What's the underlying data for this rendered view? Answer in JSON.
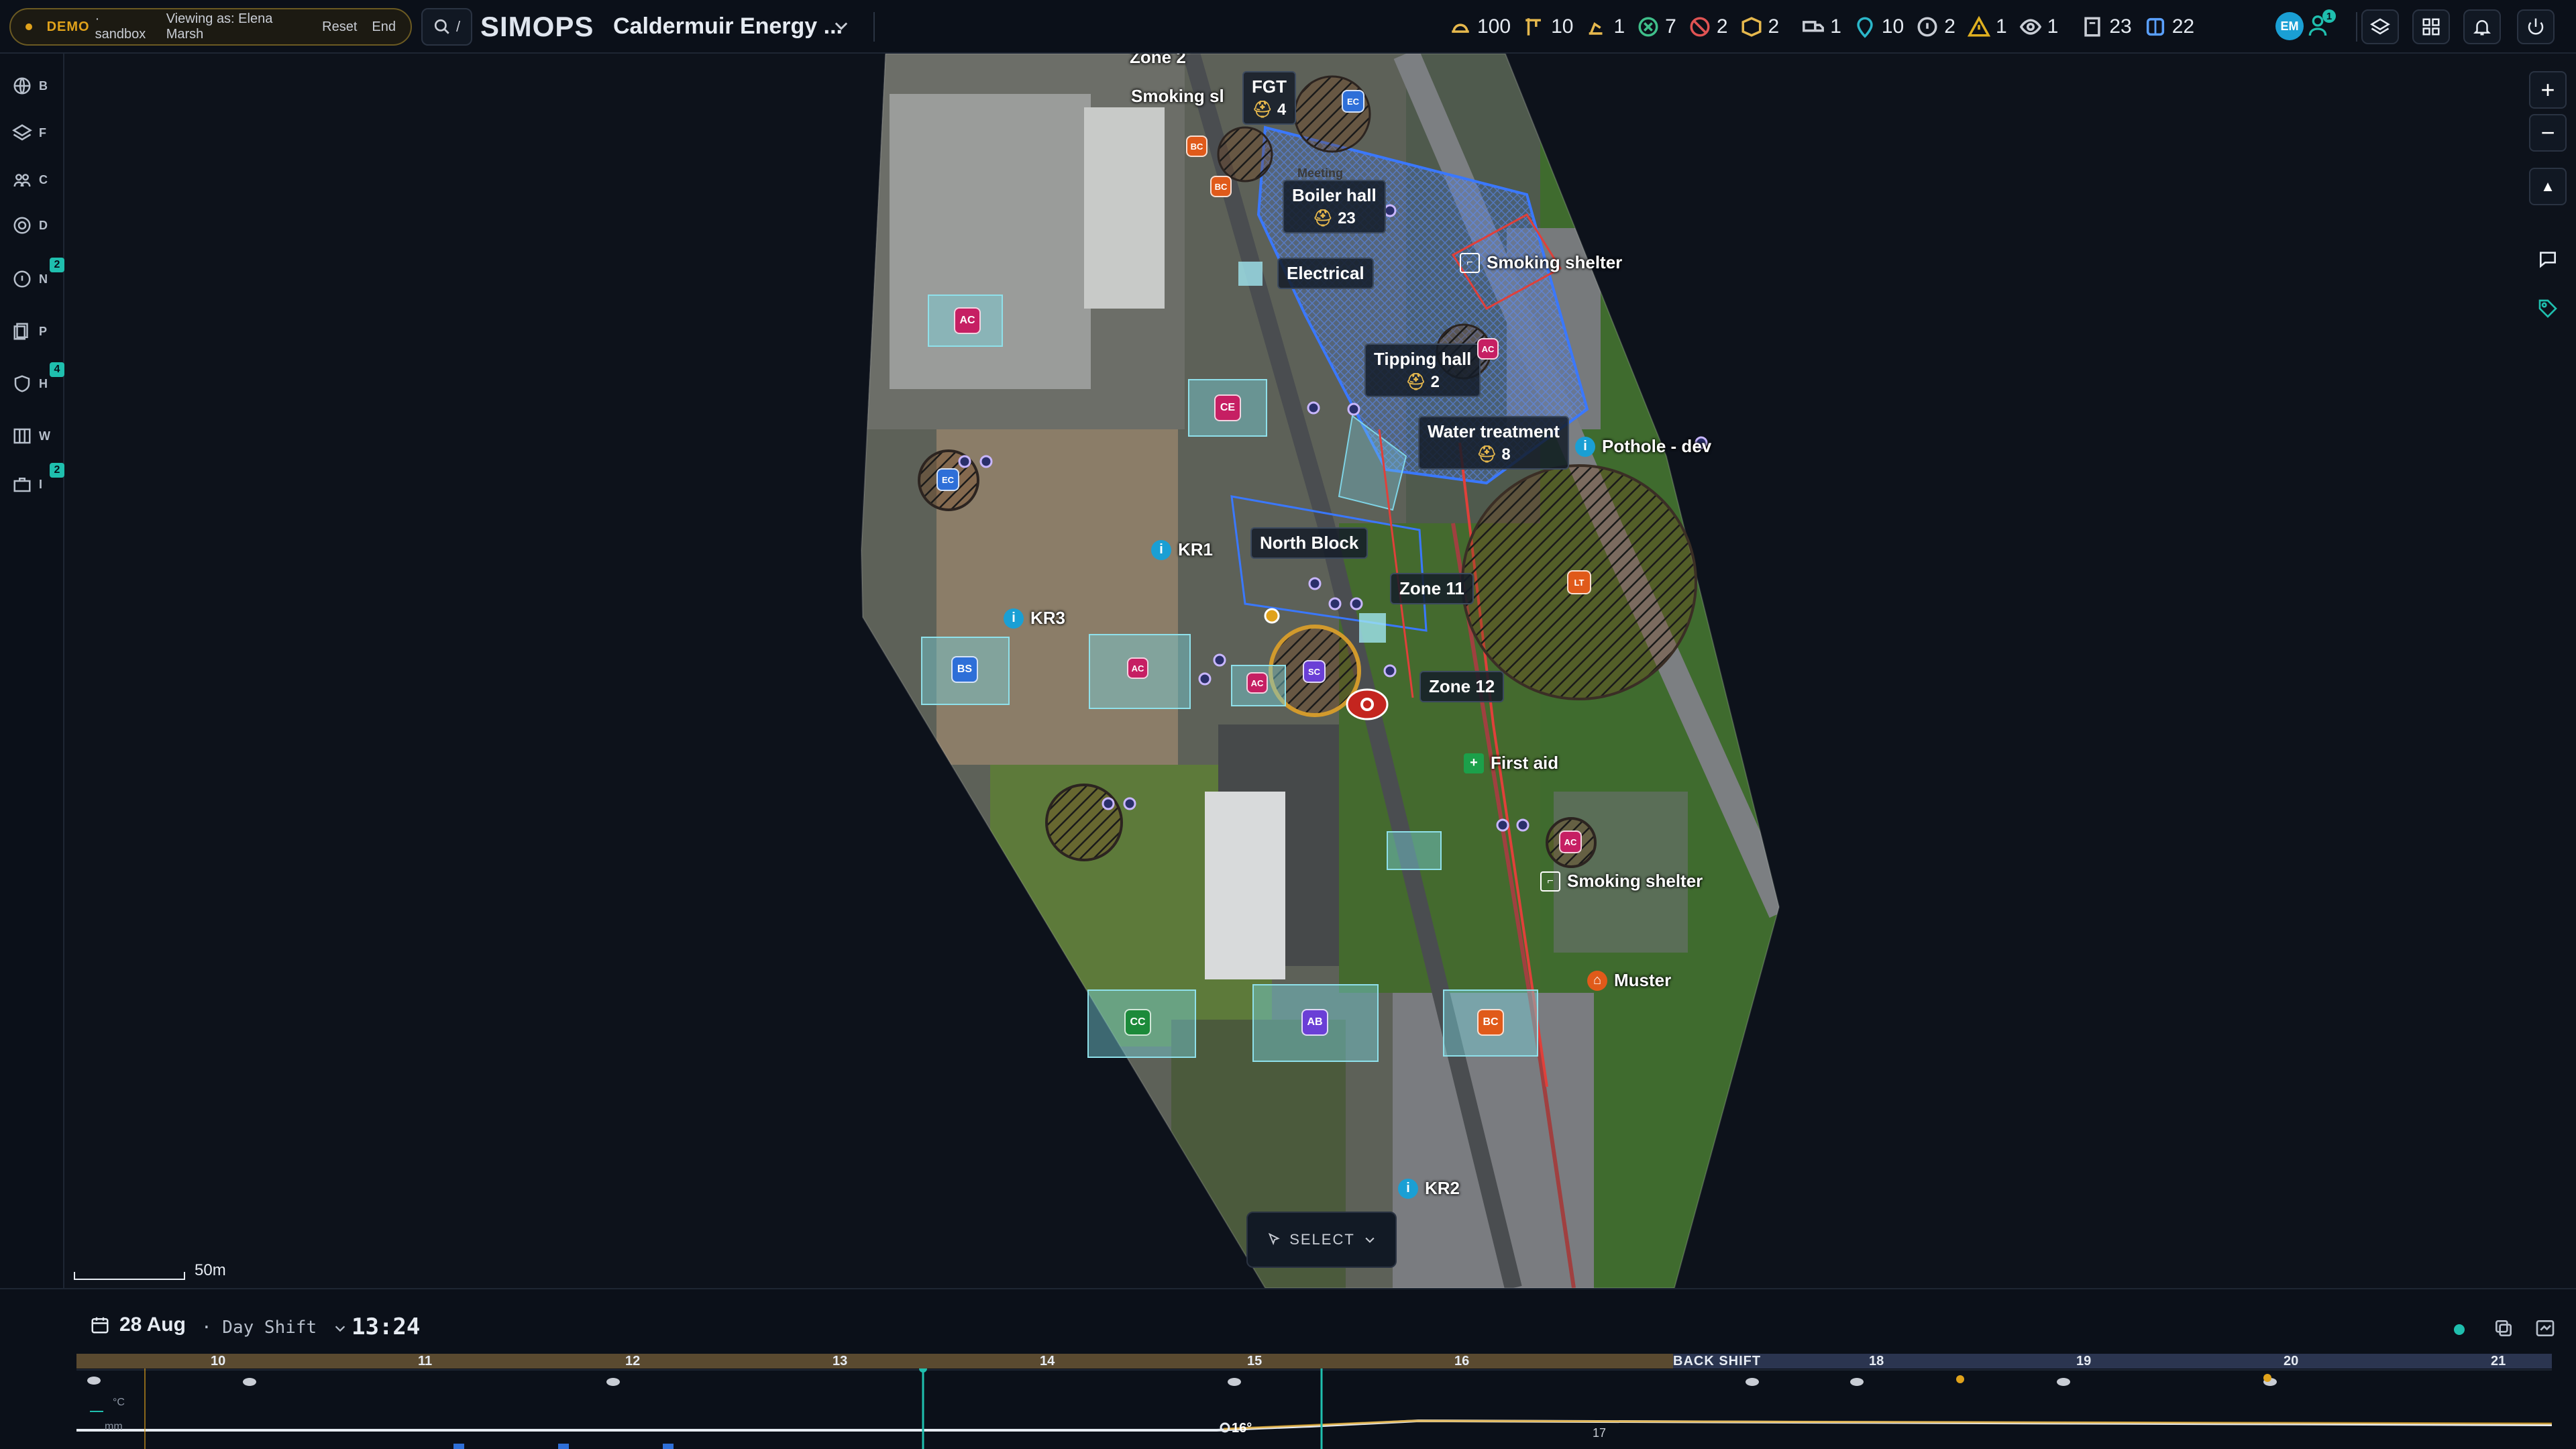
{
  "demo": {
    "tag": "DEMO",
    "env": "· sandbox",
    "viewing": "Viewing as: Elena Marsh",
    "reset": "Reset",
    "end": "End"
  },
  "search": {
    "shortcut": "/"
  },
  "app": {
    "logo": "SIMOPS",
    "site": "Caldermuir Energy ..."
  },
  "stats": [
    {
      "icon": "hardhat-icon",
      "value": "100",
      "color": "#e6b84d"
    },
    {
      "icon": "crane-icon",
      "value": "10",
      "color": "#e6b84d"
    },
    {
      "icon": "excavator-icon",
      "value": "1",
      "color": "#e6b84d"
    },
    {
      "icon": "hazard-icon",
      "value": "7",
      "color": "#3fbf8a"
    },
    {
      "icon": "prohibited-icon",
      "value": "2",
      "color": "#e05353"
    },
    {
      "icon": "box-icon",
      "value": "2",
      "color": "#e6b84d"
    },
    {
      "icon": "truck-icon",
      "value": "1",
      "color": "#c9cdd5"
    },
    {
      "icon": "location-icon",
      "value": "10",
      "color": "#2bb6c9"
    },
    {
      "icon": "info-icon",
      "value": "2",
      "color": "#c9cdd5"
    },
    {
      "icon": "warning-icon",
      "value": "1",
      "color": "#e0b020"
    },
    {
      "icon": "eye-icon",
      "value": "1",
      "color": "#c9cdd5"
    },
    {
      "icon": "building-icon",
      "value": "23",
      "color": "#c9cdd5"
    },
    {
      "icon": "grid-icon",
      "value": "22",
      "color": "#5aa0ff"
    }
  ],
  "user": {
    "initials": "EM",
    "team_badge": "1"
  },
  "rail": [
    {
      "letter": "B",
      "icon": "globe-icon",
      "badge": ""
    },
    {
      "letter": "F",
      "icon": "layers-icon",
      "badge": ""
    },
    {
      "letter": "C",
      "icon": "group-icon",
      "badge": ""
    },
    {
      "letter": "D",
      "icon": "target-icon",
      "badge": ""
    },
    {
      "letter": "N",
      "icon": "info-icon",
      "badge": "2"
    },
    {
      "letter": "P",
      "icon": "permit-icon",
      "badge": ""
    },
    {
      "letter": "H",
      "icon": "shield-icon",
      "badge": "4"
    },
    {
      "letter": "W",
      "icon": "columns-icon",
      "badge": ""
    },
    {
      "letter": "I",
      "icon": "toolbox-icon",
      "badge": "2"
    }
  ],
  "map": {
    "boxes": [
      {
        "title": "FGT",
        "count": "4"
      },
      {
        "title": "Boiler hall",
        "count": "23"
      },
      {
        "title": "Electrical",
        "count": ""
      },
      {
        "title": "Tipping hall",
        "count": "2"
      },
      {
        "title": "Water treatment",
        "count": "8"
      },
      {
        "title": "North Block",
        "count": ""
      },
      {
        "title": "Zone 11",
        "count": ""
      },
      {
        "title": "Zone 12",
        "count": ""
      }
    ],
    "labels": {
      "zone2": "Zone 2",
      "smoking1": "Smoking sl",
      "meeting": "Meeting",
      "kr1": "KR1",
      "kr3": "KR3",
      "kr2": "KR2"
    },
    "pins": [
      {
        "text": "Smoking shelter",
        "icon": "smoking-icon"
      },
      {
        "text": "Pothole - dev",
        "icon": "info-icon"
      },
      {
        "text": "First aid",
        "icon": "first-aid-icon"
      },
      {
        "text": "Smoking shelter",
        "icon": "smoking-icon"
      },
      {
        "text": "Muster",
        "icon": "muster-icon"
      }
    ],
    "markers": [
      "AC",
      "CE",
      "BS",
      "AC",
      "AC",
      "AC",
      "CC",
      "AB",
      "BC",
      "AC",
      "LT",
      "SC",
      "EC",
      "EC",
      "BC",
      "BC"
    ],
    "select_label": "SELECT",
    "scale_label": "50m"
  },
  "timeline": {
    "date": "28 Aug",
    "shift": "· Day Shift",
    "time": "13:24",
    "hours": [
      "10",
      "11",
      "12",
      "13",
      "14",
      "15",
      "16",
      "17",
      "18",
      "19",
      "20",
      "21"
    ],
    "back_shift": "BACK SHIFT",
    "temp_unit": "°C",
    "rain_unit": "mm",
    "temp_label": "16°",
    "lower_value": "17"
  },
  "colors": {
    "accent": "#1fbfae",
    "amber": "#e0a21b",
    "brand_blue": "#2e6fd8"
  }
}
